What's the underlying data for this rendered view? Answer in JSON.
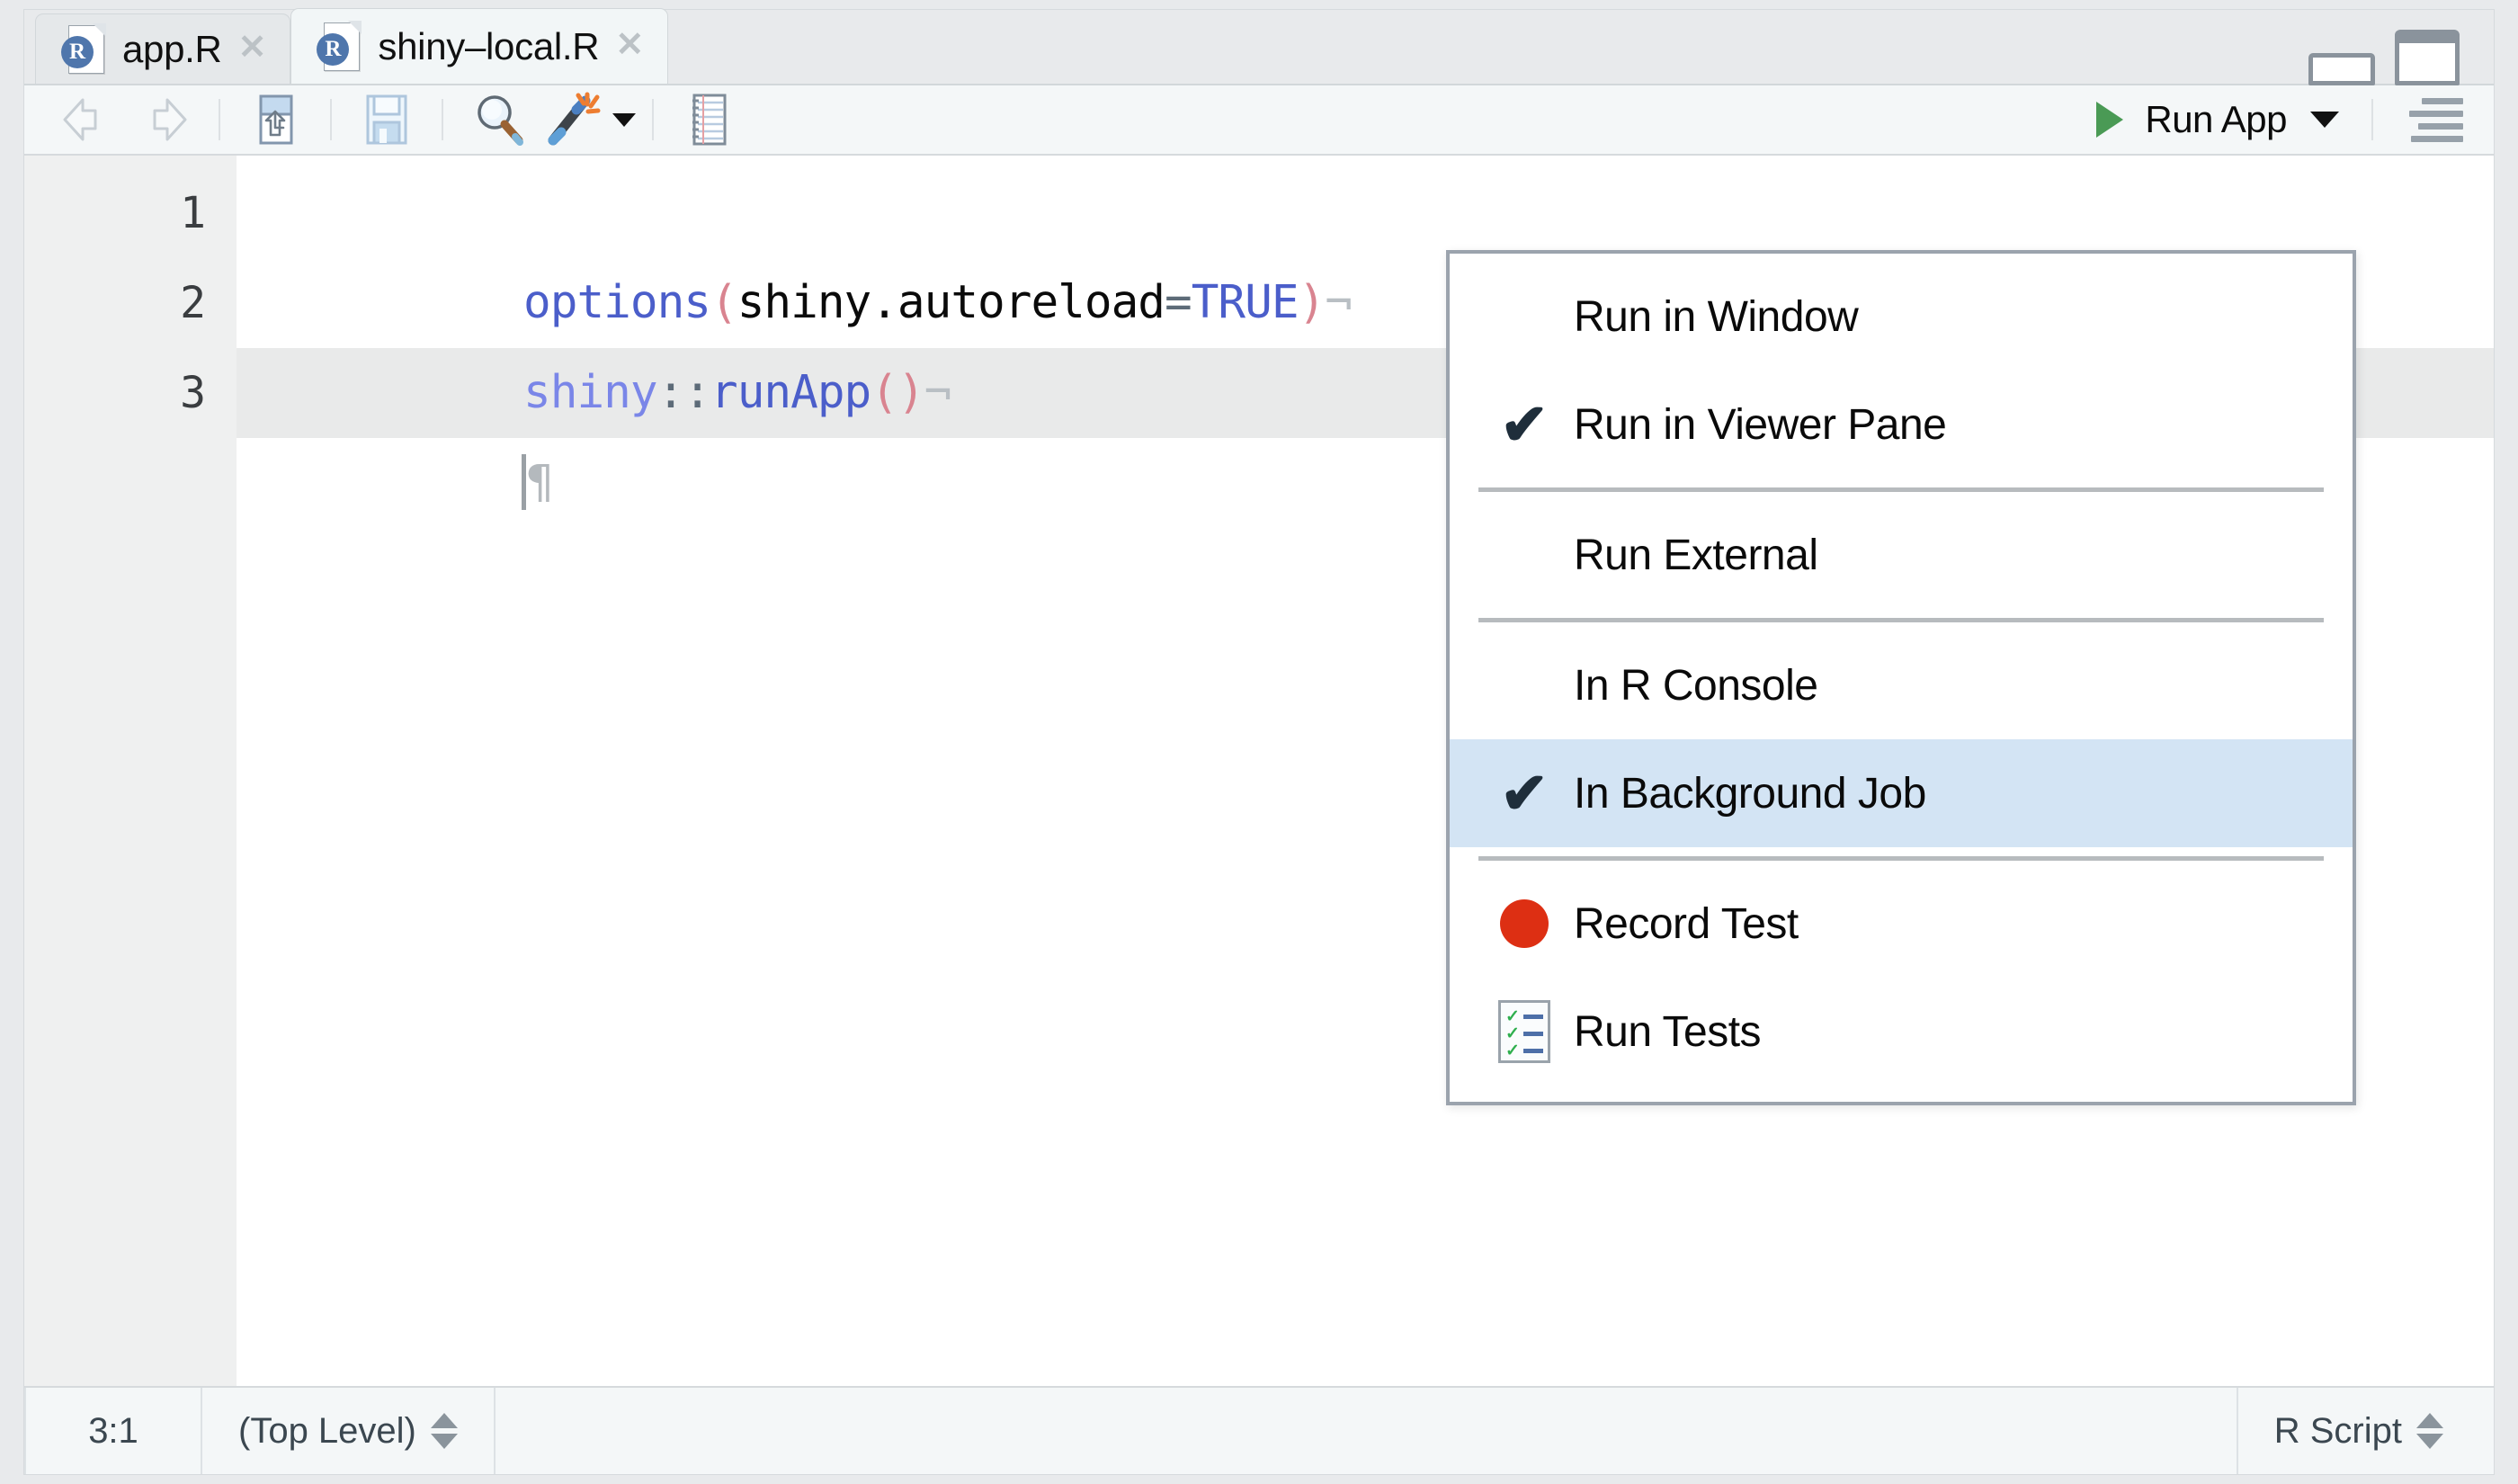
{
  "window": {
    "minimize_label": "minimize",
    "maximize_label": "maximize"
  },
  "tabs": [
    {
      "label": "app.R",
      "icon": "r-file-icon",
      "close": "✕",
      "active": false
    },
    {
      "label": "shiny–local.R",
      "icon": "r-file-icon",
      "close": "✕",
      "active": true
    }
  ],
  "toolbar": {
    "back": "back-arrow",
    "forward": "forward-arrow",
    "popout": "show-in-new-window",
    "save": "save",
    "find": "find-replace",
    "codetools": "code-tools",
    "codetools_caret": "▾",
    "compile_report": "compile-report",
    "run_app_label": "Run App",
    "run_app_caret": "▾",
    "outline": "document-outline"
  },
  "editor": {
    "lines": [
      {
        "number": "1",
        "active": false,
        "tokens": [
          {
            "t": "options",
            "c": "tok-fn"
          },
          {
            "t": "(",
            "c": "tok-paren"
          },
          {
            "t": "shiny.autoreload",
            "c": "tok-plain"
          },
          {
            "t": "=",
            "c": "tok-op"
          },
          {
            "t": "TRUE",
            "c": "tok-const"
          },
          {
            "t": ")",
            "c": "tok-paren"
          },
          {
            "t": "¬",
            "c": "eol-mark"
          }
        ]
      },
      {
        "number": "2",
        "active": false,
        "tokens": [
          {
            "t": "shiny",
            "c": "tok-pkg"
          },
          {
            "t": "::",
            "c": "tok-colons"
          },
          {
            "t": "runApp",
            "c": "tok-fn"
          },
          {
            "t": "(",
            "c": "tok-paren"
          },
          {
            "t": ")",
            "c": "tok-paren"
          },
          {
            "t": "¬",
            "c": "eol-mark"
          }
        ]
      },
      {
        "number": "3",
        "active": true,
        "tokens": [
          {
            "t": "¶",
            "c": "pilcrow"
          }
        ]
      }
    ]
  },
  "menu": {
    "items": [
      {
        "label": "Run in Window",
        "checked": false,
        "icon": null,
        "highlighted": false
      },
      {
        "label": "Run in Viewer Pane",
        "checked": true,
        "icon": null,
        "highlighted": false
      },
      {
        "separator": true
      },
      {
        "label": "Run External",
        "checked": false,
        "icon": null,
        "highlighted": false
      },
      {
        "separator": true
      },
      {
        "label": "In R Console",
        "checked": false,
        "icon": null,
        "highlighted": false
      },
      {
        "label": "In Background Job",
        "checked": true,
        "icon": null,
        "highlighted": true
      },
      {
        "separator": true
      },
      {
        "label": "Record Test",
        "checked": false,
        "icon": "record-dot-icon",
        "highlighted": false
      },
      {
        "label": "Run Tests",
        "checked": false,
        "icon": "test-list-icon",
        "highlighted": false
      }
    ],
    "check_glyph": "✔"
  },
  "statusbar": {
    "cursor_position": "3:1",
    "scope": "(Top Level)",
    "file_type": "R Script"
  },
  "colors": {
    "accent_green": "#4a9a55",
    "record_red": "#dd2f13",
    "menu_highlight": "#d3e4f4",
    "r_blue": "#4f76ac",
    "keyword_blue": "#4b5eca",
    "paren_pink": "#d98490"
  }
}
